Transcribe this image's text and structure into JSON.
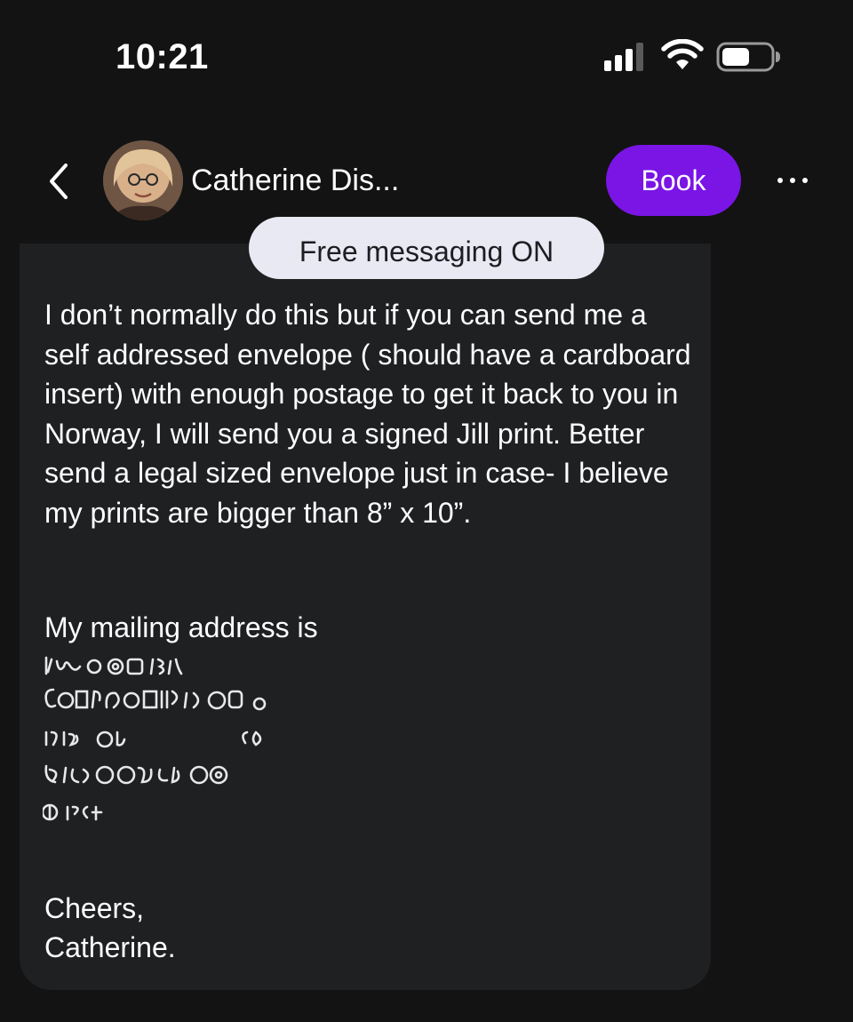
{
  "status_bar": {
    "time": "10:21",
    "signal_icon": "cellular-signal-icon",
    "wifi_icon": "wifi-icon",
    "battery_icon": "battery-icon"
  },
  "header": {
    "back_icon": "chevron-left-icon",
    "contact_name": "Catherine Dis...",
    "book_label": "Book",
    "more_icon": "more-horizontal-icon"
  },
  "message": {
    "banner": "Free messaging ON",
    "body": "I don’t normally do this but if you can send me a self addressed envelope ( should have a cardboard insert) with enough postage to get it back to you in Norway, I will send you a signed Jill print. Better send a legal sized envelope just in case- I believe my prints are bigger than 8” x 10”.",
    "mailing_label": "My mailing address is",
    "address_redacted": true,
    "signoff_line1": "Cheers,",
    "signoff_line2": "Catherine."
  },
  "colors": {
    "background": "#131313",
    "bubble": "#1f2022",
    "accent": "#7a15e6",
    "banner": "#e9e9f4"
  }
}
